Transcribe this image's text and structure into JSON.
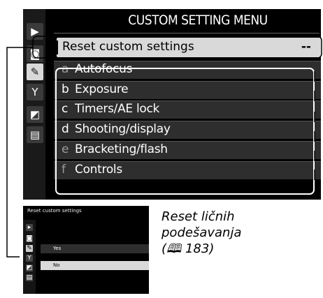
{
  "menu": {
    "title": "CUSTOM SETTING MENU",
    "reset_row": {
      "label": "Reset custom settings",
      "value": "--"
    },
    "items": [
      {
        "letter": "a",
        "label": "Autofocus"
      },
      {
        "letter": "b",
        "label": "Exposure"
      },
      {
        "letter": "c",
        "label": "Timers/AE lock"
      },
      {
        "letter": "d",
        "label": "Shooting/display"
      },
      {
        "letter": "e",
        "label": "Bracketing/flash"
      },
      {
        "letter": "f",
        "label": "Controls"
      }
    ]
  },
  "sidebar": {
    "icons": [
      "playback-icon",
      "camera-icon",
      "pencil-icon",
      "wrench-icon",
      "retouch-icon",
      "my-menu-icon"
    ],
    "active": "pencil-icon"
  },
  "inset": {
    "title": "Reset custom settings",
    "options": [
      "Yes",
      "No"
    ],
    "selected": "No"
  },
  "caption": {
    "line1": "Reset ličnih",
    "line2": "podešavanja",
    "line3": "(🕮 183)"
  },
  "colors": {
    "screen_bg": "#000000",
    "highlight": "#d9d9d9",
    "row_bg": "#2e2e2e"
  }
}
